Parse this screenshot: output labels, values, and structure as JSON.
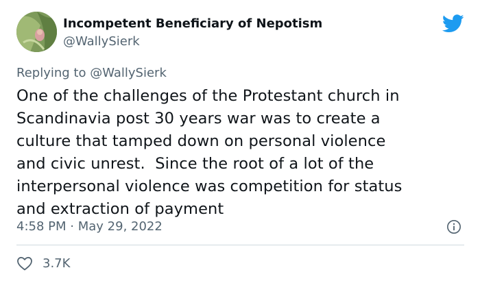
{
  "author": {
    "display_name": "Incompetent Beneficiary of Nepotism",
    "handle": "@WallySierk",
    "avatar_icon": "profile-photo"
  },
  "brand": {
    "icon": "twitter-bird-icon",
    "color": "#1d9bf0"
  },
  "reply": {
    "prefix": "Replying to",
    "mention": "@WallySierk"
  },
  "tweet": {
    "lines": [
      "One of the challenges of the Protestant church in",
      "Scandinavia post 30 years war was to create a",
      "culture that tamped down on personal violence",
      "and civic unrest.  Since the root of a lot of the",
      "interpersonal violence was competition for status",
      "and extraction of payment"
    ],
    "time": "4:58 PM",
    "separator": "·",
    "date": "May 29, 2022"
  },
  "actions": {
    "likes": "3.7K",
    "like_icon": "heart-icon",
    "info_icon": "info-icon"
  },
  "colors": {
    "text": "#0f1419",
    "secondary": "#536471",
    "divider": "#cfd9de"
  }
}
